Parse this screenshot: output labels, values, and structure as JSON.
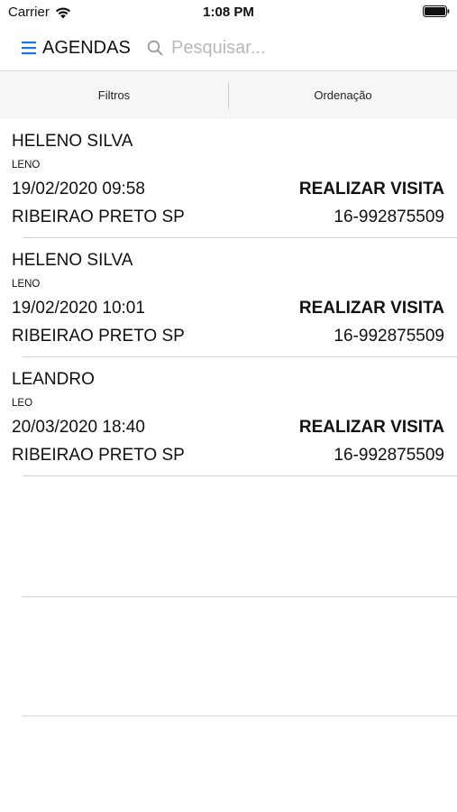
{
  "status_bar": {
    "carrier": "Carrier",
    "time": "1:08 PM"
  },
  "nav": {
    "title": "AGENDAS",
    "search_placeholder": "Pesquisar..."
  },
  "filters": {
    "filter_label": "Filtros",
    "sort_label": "Ordenação"
  },
  "colors": {
    "accent": "#1a73e8",
    "separator": "#d2d2d2",
    "filter_bg": "#f6f6f6",
    "placeholder": "#b9b9b9"
  },
  "appointments": [
    {
      "name": "HELENO SILVA",
      "nickname": "LENO",
      "datetime": "19/02/2020 09:58",
      "action": "REALIZAR VISITA",
      "city": "RIBEIRAO PRETO  SP",
      "phone": "16-992875509"
    },
    {
      "name": "HELENO SILVA",
      "nickname": "LENO",
      "datetime": "19/02/2020 10:01",
      "action": "REALIZAR VISITA",
      "city": "RIBEIRAO PRETO  SP",
      "phone": "16-992875509"
    },
    {
      "name": "LEANDRO",
      "nickname": "LEO",
      "datetime": "20/03/2020 18:40",
      "action": "REALIZAR VISITA",
      "city": "RIBEIRAO PRETO  SP",
      "phone": "16-992875509"
    }
  ]
}
